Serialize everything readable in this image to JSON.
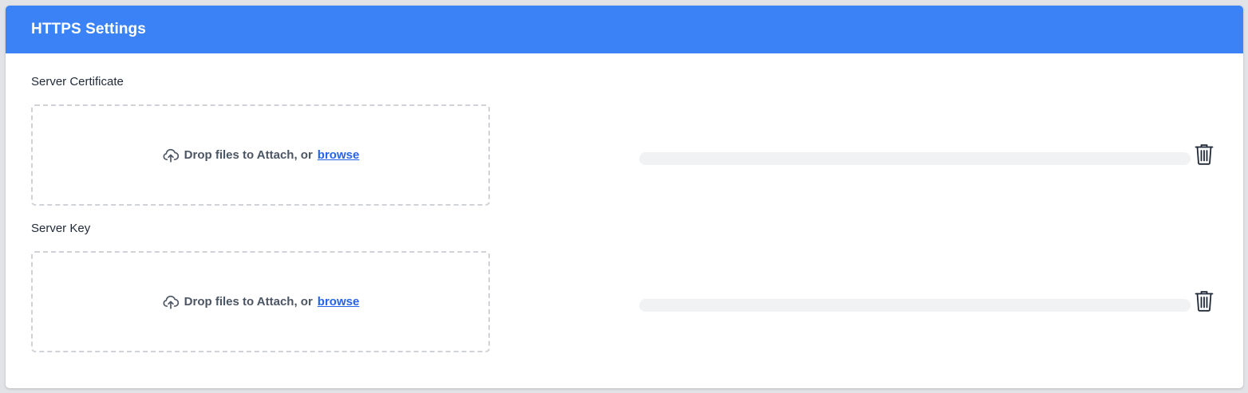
{
  "panel": {
    "title": "HTTPS Settings",
    "header_color": "#3b82f6"
  },
  "uploads": [
    {
      "label": "Server Certificate",
      "dropzone": {
        "icon": "cloud-upload-icon",
        "text": "Drop files to Attach, or",
        "link": "browse"
      },
      "progress": 0,
      "delete_icon": "trash-icon"
    },
    {
      "label": "Server Key",
      "dropzone": {
        "icon": "cloud-upload-icon",
        "text": "Drop files to Attach, or",
        "link": "browse"
      },
      "progress": 0,
      "delete_icon": "trash-icon"
    }
  ]
}
